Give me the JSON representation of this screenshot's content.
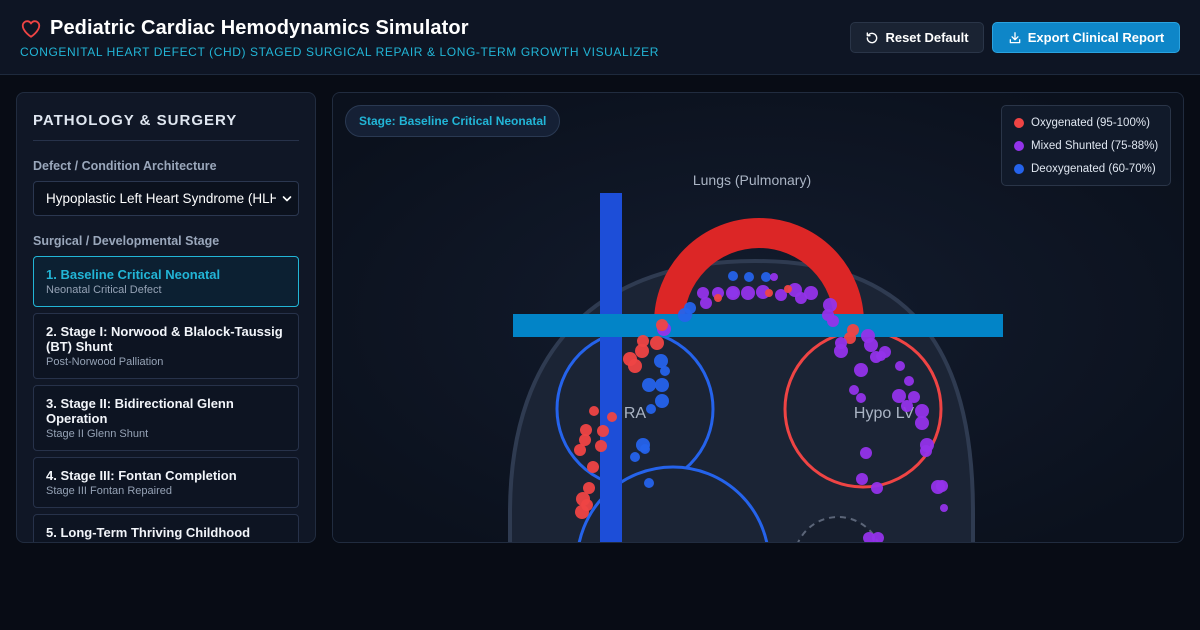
{
  "header": {
    "title": "Pediatric Cardiac Hemodynamics Simulator",
    "subtitle": "CONGENITAL HEART DEFECT (CHD) STAGED SURGICAL REPAIR & LONG-TERM GROWTH VISUALIZER",
    "heart_icon": "heart-icon",
    "reset_label": "Reset Default",
    "reset_icon": "reset-icon",
    "export_label": "Export Clinical Report",
    "export_icon": "download-icon"
  },
  "sidebar": {
    "title": "PATHOLOGY & SURGERY",
    "defect_label": "Defect / Condition Architecture",
    "defect_value": "Hypoplastic Left Heart Syndrome (HLHS)",
    "stage_label": "Surgical / Developmental Stage",
    "stages": [
      {
        "title": "1. Baseline Critical Neonatal",
        "subtitle": "Neonatal Critical Defect",
        "active": true
      },
      {
        "title": "2. Stage I: Norwood & Blalock-Taussig (BT) Shunt",
        "subtitle": "Post-Norwood Palliation",
        "active": false
      },
      {
        "title": "3. Stage II: Bidirectional Glenn Operation",
        "subtitle": "Stage II Glenn Shunt",
        "active": false
      },
      {
        "title": "4. Stage III: Fontan Completion",
        "subtitle": "Stage III Fontan Repaired",
        "active": false
      },
      {
        "title": "5. Long-Term Thriving Childhood",
        "subtitle": "",
        "active": false
      }
    ]
  },
  "main": {
    "stage_badge": "Stage: Baseline Critical Neonatal",
    "legend": [
      {
        "label": "Oxygenated (95-100%)",
        "color": "#ef4444"
      },
      {
        "label": "Mixed Shunted (75-88%)",
        "color": "#9333ea"
      },
      {
        "label": "Deoxygenated (60-70%)",
        "color": "#2563eb"
      }
    ],
    "diagram": {
      "lungs_label": "Lungs (Pulmonary)",
      "ra_label": "RA",
      "lv_label": "Hypo LV"
    }
  },
  "colors": {
    "accent": "#22b5d6",
    "oxygenated": "#ef4444",
    "mixed": "#9333ea",
    "deoxygenated": "#2563eb",
    "aorta": "#dc2626",
    "pulmonary": "#0284c7"
  }
}
